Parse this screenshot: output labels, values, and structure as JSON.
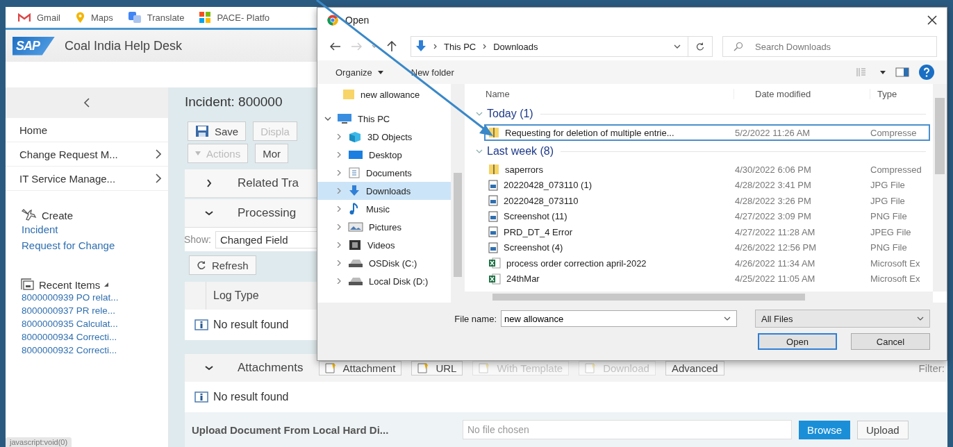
{
  "bookmarks": [
    {
      "label": "Gmail",
      "kind": "mail"
    },
    {
      "label": "Maps",
      "kind": "pin"
    },
    {
      "label": "Translate",
      "kind": "translate"
    },
    {
      "label": "PACE- Platfo",
      "kind": "tiles"
    }
  ],
  "header": {
    "logo": "SAP",
    "title": "Coal India Help Desk"
  },
  "sidebar": {
    "nav": [
      {
        "label": "Home",
        "has_children": false
      },
      {
        "label": "Change Request M...",
        "has_children": true
      },
      {
        "label": "IT Service Manage...",
        "has_children": true
      }
    ],
    "create": {
      "title": "Create",
      "links": [
        "Incident",
        "Request for Change"
      ]
    },
    "recent": {
      "title": "Recent Items",
      "links": [
        "8000000939 PO relat...",
        "8000000937 PR rele...",
        "8000000935 Calculat...",
        "8000000934 Correcti...",
        "8000000932 Correcti..."
      ]
    }
  },
  "incident": {
    "title": "Incident: 800000",
    "toolbar": [
      {
        "label": "Save",
        "kind": "save",
        "disabled": false
      },
      {
        "label": "Displa",
        "kind": "plain",
        "disabled": true
      },
      {
        "label": "Actions",
        "kind": "menu",
        "disabled": true
      },
      {
        "label": "Mor",
        "kind": "plain",
        "disabled": false
      }
    ],
    "sections": [
      {
        "title": "Related Tra",
        "expanded": false
      },
      {
        "title": "Processing",
        "expanded": true
      }
    ],
    "show_label": "Show:",
    "show_value": "Changed Field",
    "refresh": "Refresh",
    "log_column": "Log Type",
    "log_empty": "No result found",
    "attachments": {
      "title": "Attachments",
      "expanded": true,
      "buttons": [
        {
          "label": "Attachment",
          "disabled": false,
          "icon": true
        },
        {
          "label": "URL",
          "disabled": false,
          "icon": true
        },
        {
          "label": "With Template",
          "disabled": true,
          "icon": true
        },
        {
          "label": "Download",
          "disabled": true,
          "icon": true
        },
        {
          "label": "Advanced",
          "disabled": false,
          "icon": false
        }
      ],
      "filter": "Filter:",
      "empty": "No result found"
    },
    "upload": {
      "label": "Upload Document From Local Hard Di...",
      "placeholder": "No file chosen",
      "browse": "Browse",
      "upload": "Upload"
    }
  },
  "status_bar": "javascript:void(0)",
  "dialog": {
    "title": "Open",
    "path": [
      "This PC",
      "Downloads"
    ],
    "search_placeholder": "Search Downloads",
    "organize": "Organize",
    "new_folder": "New folder",
    "nav": [
      {
        "label": "new allowance",
        "kind": "folder",
        "selected": false
      },
      {
        "label": "This PC",
        "kind": "pc",
        "selected": false,
        "expanded": true
      },
      {
        "label": "3D Objects",
        "kind": "cube",
        "selected": false,
        "expanded": false
      },
      {
        "label": "Desktop",
        "kind": "desktop",
        "selected": false,
        "expanded": false
      },
      {
        "label": "Documents",
        "kind": "documents",
        "selected": false,
        "expanded": false
      },
      {
        "label": "Downloads",
        "kind": "downloads",
        "selected": true,
        "expanded": false
      },
      {
        "label": "Music",
        "kind": "music",
        "selected": false,
        "expanded": false
      },
      {
        "label": "Pictures",
        "kind": "pictures",
        "selected": false,
        "expanded": false
      },
      {
        "label": "Videos",
        "kind": "videos",
        "selected": false,
        "expanded": false
      },
      {
        "label": "OSDisk (C:)",
        "kind": "disk",
        "selected": false,
        "expanded": false
      },
      {
        "label": "Local Disk (D:)",
        "kind": "disk",
        "selected": false,
        "expanded": false
      }
    ],
    "columns": [
      "Name",
      "Date modified",
      "Type"
    ],
    "groups": [
      {
        "title": "Today (1)",
        "files": [
          {
            "name": "Requesting for deletion of multiple entrie...",
            "date": "5/2/2022 11:26 AM",
            "type": "Compresse",
            "kind": "zip",
            "selected": true
          }
        ]
      },
      {
        "title": "Last week (8)",
        "files": [
          {
            "name": "saperrors",
            "date": "4/30/2022 6:06 PM",
            "type": "Compressed",
            "kind": "zip",
            "selected": false
          },
          {
            "name": "20220428_073110 (1)",
            "date": "4/28/2022 3:41 PM",
            "type": "JPG File",
            "kind": "image",
            "selected": false
          },
          {
            "name": "20220428_073110",
            "date": "4/28/2022 3:26 PM",
            "type": "JPG File",
            "kind": "image",
            "selected": false
          },
          {
            "name": "Screenshot (11)",
            "date": "4/27/2022 3:09 PM",
            "type": "PNG File",
            "kind": "image",
            "selected": false
          },
          {
            "name": "PRD_DT_4 Error",
            "date": "4/27/2022 11:28 AM",
            "type": "JPEG File",
            "kind": "image",
            "selected": false
          },
          {
            "name": "Screenshot (4)",
            "date": "4/26/2022 12:56 PM",
            "type": "PNG File",
            "kind": "image",
            "selected": false
          },
          {
            "name": "process order correction april-2022",
            "date": "4/26/2022 11:34 AM",
            "type": "Microsoft Ex",
            "kind": "excel",
            "selected": false
          },
          {
            "name": "24thMar",
            "date": "4/25/2022 11:05 AM",
            "type": "Microsoft Ex",
            "kind": "excel",
            "selected": false
          }
        ]
      }
    ],
    "file_name_label": "File name:",
    "file_name": "new allowance",
    "filter": "All Files",
    "open": "Open",
    "cancel": "Cancel"
  }
}
